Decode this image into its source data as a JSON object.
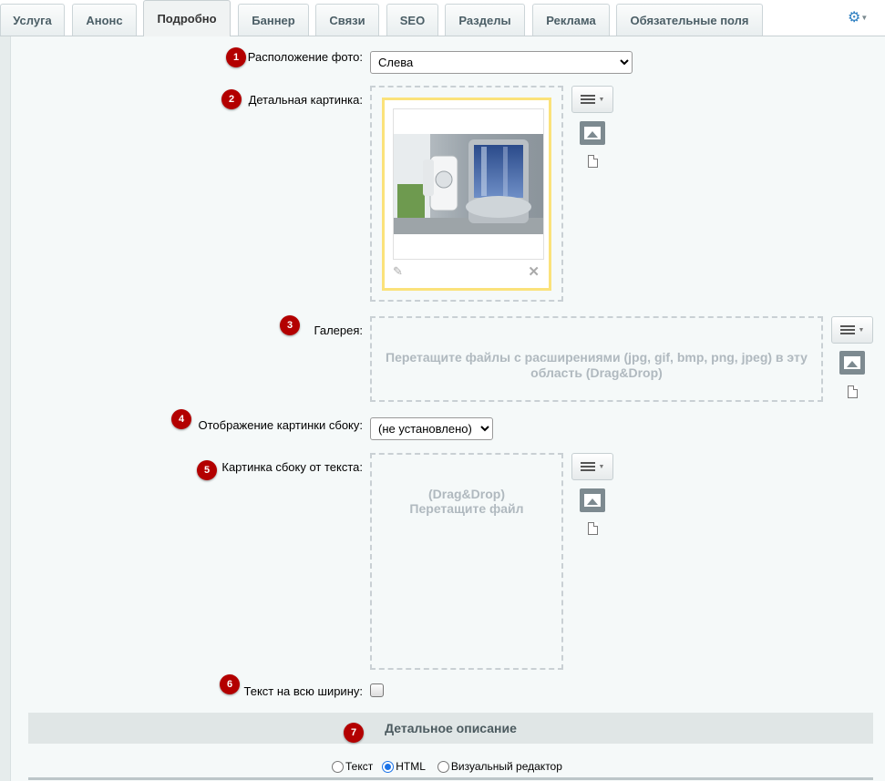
{
  "tabs": [
    {
      "label": "Услуга",
      "active": false
    },
    {
      "label": "Анонс",
      "active": false
    },
    {
      "label": "Подробно",
      "active": true
    },
    {
      "label": "Баннер",
      "active": false
    },
    {
      "label": "Связи",
      "active": false
    },
    {
      "label": "SEO",
      "active": false
    },
    {
      "label": "Разделы",
      "active": false
    },
    {
      "label": "Реклама",
      "active": false
    },
    {
      "label": "Обязательные поля",
      "active": false
    }
  ],
  "settings_icon": "gear-icon",
  "fields": {
    "photo_position": {
      "badge": "1",
      "label": "Расположение фото:",
      "value": "Слева"
    },
    "detail_picture": {
      "badge": "2",
      "label": "Детальная картинка:"
    },
    "gallery": {
      "badge": "3",
      "label": "Галерея:",
      "dropzone_text": "Перетащите файлы с расширениями (jpg, gif, bmp, png, jpeg) в эту область (Drag&Drop)"
    },
    "side_picture_display": {
      "badge": "4",
      "label": "Отображение картинки сбоку:",
      "value": "(не установлено)"
    },
    "side_picture": {
      "badge": "5",
      "label": "Картинка сбоку от текста:",
      "dropzone_line1": "(Drag&Drop)",
      "dropzone_line2": "Перетащите файл"
    },
    "full_width_text": {
      "badge": "6",
      "label": "Текст на всю ширину:",
      "checked": false
    }
  },
  "section": {
    "badge": "7",
    "title": "Детальное описание"
  },
  "editor_modes": [
    {
      "label": "Текст",
      "selected": false
    },
    {
      "label": "HTML",
      "selected": true
    },
    {
      "label": "Визуальный редактор",
      "selected": false
    }
  ],
  "colors": {
    "badge": "#b30000",
    "accent": "#2e7fc1",
    "highlight_border": "#fbe27a"
  }
}
